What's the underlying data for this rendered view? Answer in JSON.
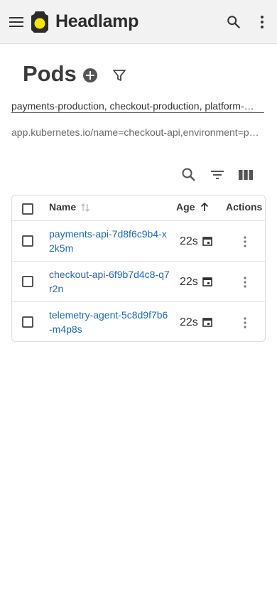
{
  "appbar": {
    "brand": "Headlamp",
    "menu_icon": "hamburger-menu-icon",
    "logo_icon": "headlamp-logo-icon",
    "search_icon": "search-icon",
    "more_icon": "more-vertical-icon"
  },
  "page": {
    "title": "Pods",
    "add_icon": "add-circle-icon",
    "filter_icon": "filter-funnel-icon",
    "namespaces": "payments-production, checkout-production, platform-…",
    "label_selector": "app.kubernetes.io/name=checkout-api,environment=p…"
  },
  "toolbar": {
    "search_icon": "search-icon",
    "filter_icon": "filter-list-icon",
    "columns_icon": "view-columns-icon"
  },
  "table": {
    "columns": {
      "name": "Name",
      "age": "Age",
      "actions": "Actions"
    },
    "rows": [
      {
        "name": "payments-api-7d8f6c9b4-x2k5m",
        "age": "22s"
      },
      {
        "name": "checkout-api-6f9b7d4c8-q7r2n",
        "age": "22s"
      },
      {
        "name": "telemetry-agent-5c8d9f7b6-m4p8s",
        "age": "22s"
      }
    ]
  },
  "colors": {
    "appbar_bg": "#f2f2f2",
    "link": "#1c6ac2",
    "logo_yellow": "#f7e600",
    "text": "#3a3a3a"
  }
}
